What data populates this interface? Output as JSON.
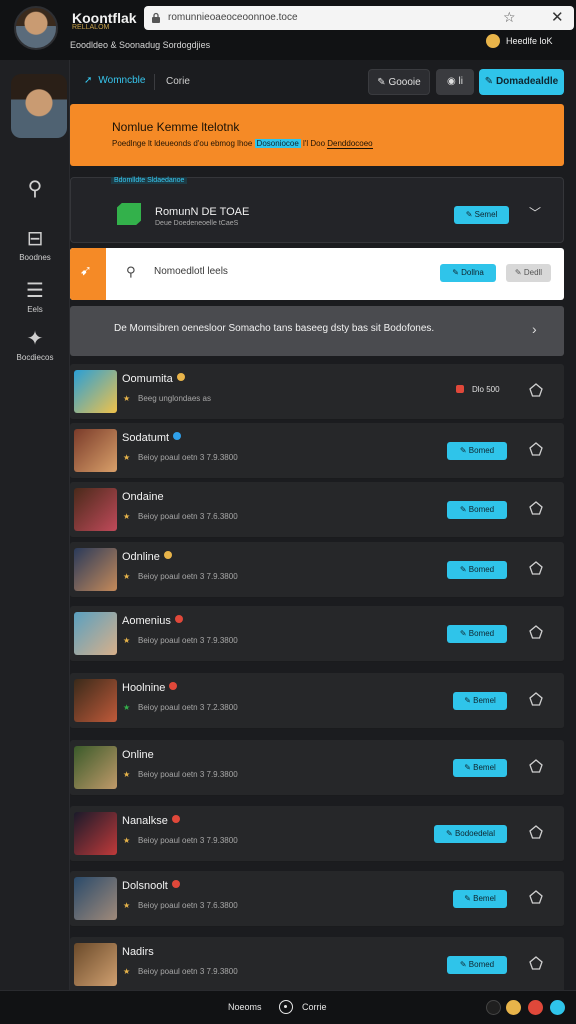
{
  "window": {
    "app_name": "Koontflak",
    "app_sub": "RELLALOM",
    "tagline": "Eoodldeo & Soonadug Sordogdjies",
    "url": "romunnieoaeoceoonnoe.toce",
    "points": "Heedlfe loK"
  },
  "sidebar": {
    "items": [
      {
        "label": "",
        "icon": "rocket-icon"
      },
      {
        "label": "Boodnes",
        "icon": "grid-icon"
      },
      {
        "label": "Eels",
        "icon": "list-icon"
      },
      {
        "label": "Bocdiecos",
        "icon": "puzzle-icon"
      }
    ]
  },
  "header": {
    "tab_active": "Womncble",
    "tab_other": "Corie",
    "btn1": "Goooie",
    "btn2": "li",
    "btn3": "Domadealdle"
  },
  "banner": {
    "title": "Nomlue Kemme ltelotnk",
    "sub_a": "Poedlnge lt ldeueonds d'ou ebmog lhoe",
    "sub_hl": "Dosoniocoe",
    "sub_b": "l'l Doo",
    "sub_link": "Denddocoeo"
  },
  "game_card": {
    "tag": "Bdomlldte Sldaedanoe",
    "title": "RomunN DE TOAE",
    "sub": "Deue Doedeneoelle tCaeS",
    "button": "Semel"
  },
  "notice": {
    "text": "Nomoedlotl leels",
    "btn_primary": "Dollna",
    "btn_secondary": "Dedll"
  },
  "promo": {
    "text": "De Momsibren oenesloor Somacho tans baseeg dsty bas sit Bodofones."
  },
  "players": [
    {
      "name": "Oomumita",
      "meta": "Beeg unglondaes as",
      "button": "",
      "count": "Dlo 500"
    },
    {
      "name": "Sodatumt",
      "meta": "Beioy poaul oetn 3 7.9.3800",
      "button": "Bomed",
      "count": ""
    },
    {
      "name": "Ondaine",
      "meta": "Beioy poaul oetn 3 7.6.3800",
      "button": "Bomed",
      "count": ""
    },
    {
      "name": "Odnline",
      "meta": "Beioy poaul oetn 3 7.9.3800",
      "button": "Bomed",
      "count": ""
    },
    {
      "name": "Aomenius",
      "meta": "Beioy poaul oetn 3 7.9.3800",
      "button": "Bomed",
      "count": ""
    },
    {
      "name": "Hoolnine",
      "meta": "Beioy poaul oetn 3 7.2.3800",
      "button": "Bemel",
      "count": ""
    },
    {
      "name": "Online",
      "meta": "Beioy poaul oetn 3 7.9.3800",
      "button": "Bemel",
      "count": ""
    },
    {
      "name": "Nanalkse",
      "meta": "Beioy poaul oetn 3 7.9.3800",
      "button": "Bodoedelal",
      "count": ""
    },
    {
      "name": "Dolsnoolt",
      "meta": "Beioy poaul oetn 3 7.6.3800",
      "button": "Bemel",
      "count": ""
    },
    {
      "name": "Nadirs",
      "meta": "Beioy poaul oetn 3 7.9.3800",
      "button": "Bomed",
      "count": ""
    }
  ],
  "footer": {
    "left": "Noeoms",
    "right": "Corrie"
  },
  "colors": {
    "accent": "#2fc4ea",
    "orange": "#f58a26",
    "bg": "#1b1c1f"
  }
}
